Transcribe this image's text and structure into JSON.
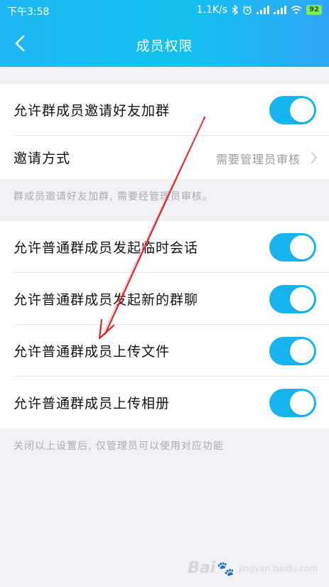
{
  "status_bar": {
    "time": "下午3:58",
    "speed": "1.1K/s",
    "battery": "92"
  },
  "nav": {
    "title": "成员权限"
  },
  "group1": {
    "invite_friends": {
      "label": "允许群成员邀请好友加群",
      "enabled": true
    },
    "invite_method": {
      "label": "邀请方式",
      "value": "需要管理员审核"
    },
    "hint": "群成员邀请好友加群, 需要经管理员审核。"
  },
  "group2": {
    "items": [
      {
        "label": "允许普通群成员发起临时会话",
        "enabled": true
      },
      {
        "label": "允许普通群成员发起新的群聊",
        "enabled": true
      },
      {
        "label": "允许普通群成员上传文件",
        "enabled": true
      },
      {
        "label": "允许普通群成员上传相册",
        "enabled": true
      }
    ],
    "hint": "关闭以上设置后, 仅管理员可以使用对应功能"
  },
  "watermark": {
    "brand": "Bai",
    "sub": "jingyan.baidu.com"
  },
  "colors": {
    "accent": "#16b5f0",
    "annotation_arrow": "#d8282c"
  }
}
